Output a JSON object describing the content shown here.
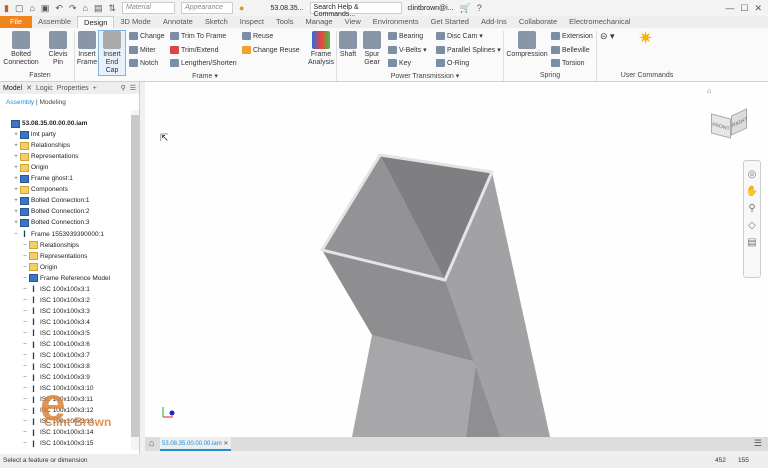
{
  "qat": {
    "material": "Material",
    "appearance": "Appearance",
    "doc": "53.08.35...",
    "search_placeholder": "Search Help & Commands...",
    "user": "clintbrown@i..."
  },
  "tabs": [
    "File",
    "Assemble",
    "Design",
    "3D Mode",
    "Annotate",
    "Sketch",
    "Inspect",
    "Tools",
    "Manage",
    "View",
    "Environments",
    "Get Started",
    "Add-Ins",
    "Collaborate",
    "Electromechanical"
  ],
  "active_tab": "Design",
  "ribbon": {
    "fasten": {
      "label": "Fasten",
      "bolted": "Bolted Connection",
      "clevis": "Clevis Pin"
    },
    "frame": {
      "label": "Frame ▾",
      "insert_frame": "Insert Frame",
      "insert_end_cap": "Insert End Cap",
      "change": "Change",
      "miter": "Miter",
      "notch": "Notch",
      "trim_to_frame": "Trim To Frame",
      "trim_extend": "Trim/Extend",
      "lengthen": "Lengthen/Shorten",
      "reuse": "Reuse",
      "change_reuse": "Change Reuse",
      "analysis": "Frame Analysis"
    },
    "pt": {
      "label": "Power Transmission ▾",
      "shaft": "Shaft",
      "spur": "Spur Gear",
      "bearing": "Bearing",
      "vbelts": "V-Belts",
      "key": "Key",
      "disc_cam": "Disc Cam",
      "splines": "Parallel Splines",
      "oring": "O-Ring"
    },
    "spring": {
      "label": "Spring",
      "compression": "Compression",
      "extension": "Extension",
      "belleville": "Belleville",
      "torsion": "Torsion"
    },
    "user": {
      "label": "User Commands"
    }
  },
  "panel": {
    "tabs": [
      "Model",
      "Logic",
      "Properties"
    ],
    "mode_assembly": "Assembly",
    "mode_modeling": "Modeling",
    "tree": [
      {
        "label": "53.08.35.00.00.00.iam",
        "lvl": 0,
        "icon": "asm"
      },
      {
        "label": "lmt party",
        "lvl": 1,
        "icon": "asm"
      },
      {
        "label": "Relationships",
        "lvl": 1,
        "icon": "folder"
      },
      {
        "label": "Representations",
        "lvl": 1,
        "icon": "folder"
      },
      {
        "label": "Origin",
        "lvl": 1,
        "icon": "folder"
      },
      {
        "label": "Frame ghost:1",
        "lvl": 1,
        "icon": "asm"
      },
      {
        "label": "Components",
        "lvl": 1,
        "icon": "folder"
      },
      {
        "label": "Bolted Connection:1",
        "lvl": 1,
        "icon": "asm"
      },
      {
        "label": "Bolted Connection:2",
        "lvl": 1,
        "icon": "asm"
      },
      {
        "label": "Bolted Connection:3",
        "lvl": 1,
        "icon": "asm"
      },
      {
        "label": "Frame 1553939390000:1",
        "lvl": 1,
        "icon": "beam"
      },
      {
        "label": "Relationships",
        "lvl": 2,
        "icon": "folder"
      },
      {
        "label": "Representations",
        "lvl": 2,
        "icon": "folder"
      },
      {
        "label": "Origin",
        "lvl": 2,
        "icon": "folder"
      },
      {
        "label": "Frame Reference Model",
        "lvl": 2,
        "icon": "asm"
      },
      {
        "label": "ISC 100x100x3:1",
        "lvl": 2,
        "icon": "beam"
      },
      {
        "label": "ISC 100x100x3:2",
        "lvl": 2,
        "icon": "beam"
      },
      {
        "label": "ISC 100x100x3:3",
        "lvl": 2,
        "icon": "beam"
      },
      {
        "label": "ISC 100x100x3:4",
        "lvl": 2,
        "icon": "beam"
      },
      {
        "label": "ISC 100x100x3:5",
        "lvl": 2,
        "icon": "beam"
      },
      {
        "label": "ISC 100x100x3:6",
        "lvl": 2,
        "icon": "beam"
      },
      {
        "label": "ISC 100x100x3:7",
        "lvl": 2,
        "icon": "beam"
      },
      {
        "label": "ISC 100x100x3:8",
        "lvl": 2,
        "icon": "beam"
      },
      {
        "label": "ISC 100x100x3:9",
        "lvl": 2,
        "icon": "beam"
      },
      {
        "label": "ISC 100x100x3:10",
        "lvl": 2,
        "icon": "beam"
      },
      {
        "label": "ISC 100x100x3:11",
        "lvl": 2,
        "icon": "beam"
      },
      {
        "label": "ISC 100x100x3:12",
        "lvl": 2,
        "icon": "beam"
      },
      {
        "label": "ISC 100x100x3:13",
        "lvl": 2,
        "icon": "beam"
      },
      {
        "label": "ISC 100x100x3:14",
        "lvl": 2,
        "icon": "beam"
      },
      {
        "label": "ISC 100x100x3:15",
        "lvl": 2,
        "icon": "beam"
      }
    ]
  },
  "watermark": "Clint Brown",
  "viewcube": {
    "front": "FRONT",
    "right": "RIGHT"
  },
  "doc_tab": "53.08.35.00.00.00.iam",
  "status": {
    "message": "Select a feature or dimension",
    "n1": "452",
    "n2": "155"
  },
  "colors": {
    "file_tab": "#f0841c",
    "accent": "#1e90d6"
  }
}
